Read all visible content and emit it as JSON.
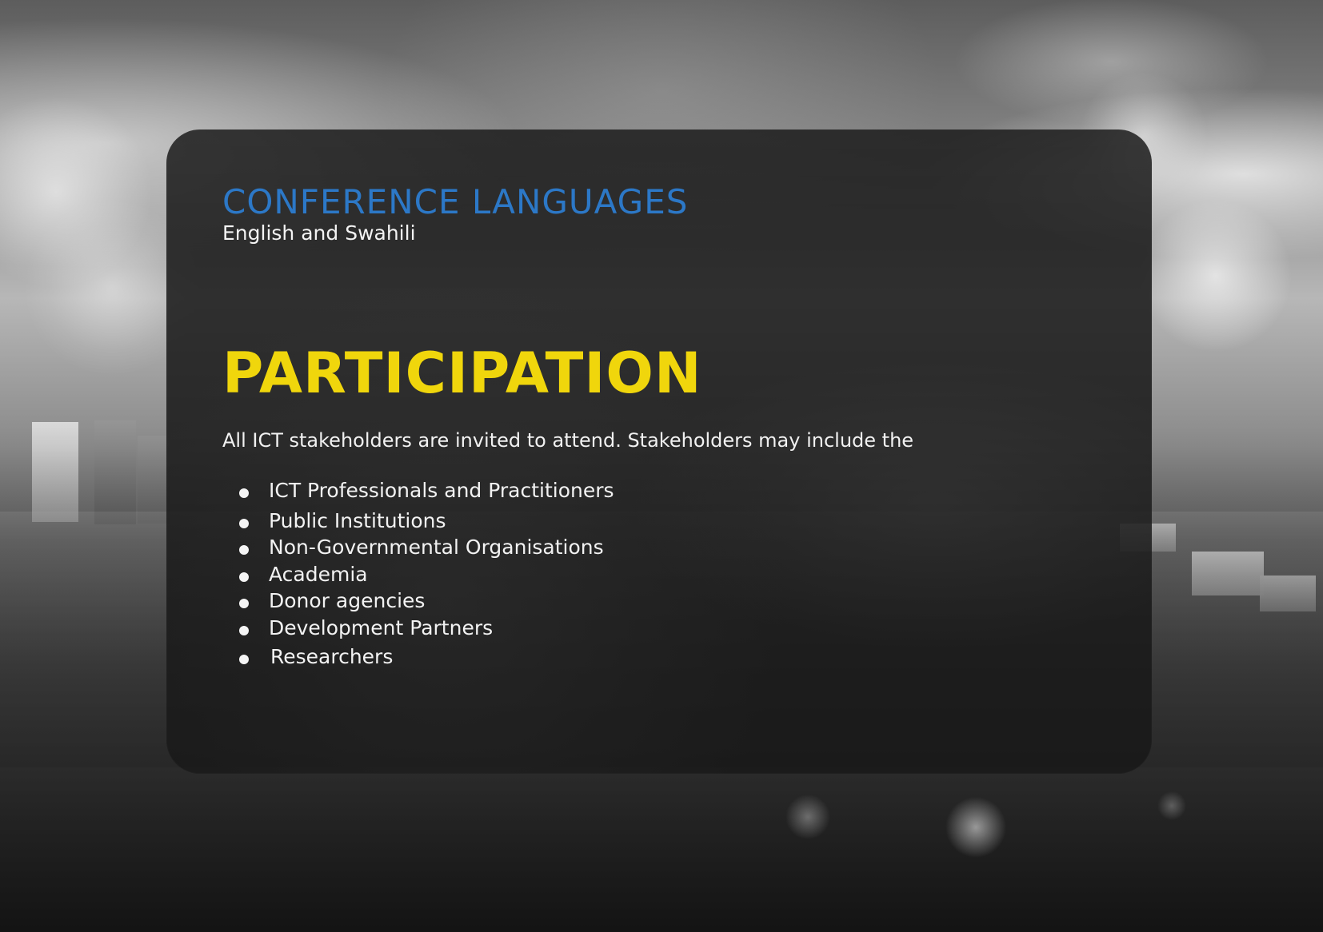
{
  "conference_languages": {
    "title": "CONFERENCE LANGUAGES",
    "text": "English and Swahili"
  },
  "participation": {
    "title": "PARTICIPATION",
    "intro": "All ICT stakeholders are invited to attend. Stakeholders may include the",
    "items": [
      "ICT Professionals and Practitioners",
      "Public Institutions",
      "Non-Governmental Organisations",
      "Academia",
      "Donor agencies",
      "Development Partners",
      "Researchers"
    ]
  },
  "colors": {
    "title_blue": "#2c78c7",
    "title_yellow": "#f0d60c",
    "text_white": "#f2f2f2",
    "panel_dark": "#181818"
  },
  "icons": {
    "bullet": "bullet-icon"
  }
}
